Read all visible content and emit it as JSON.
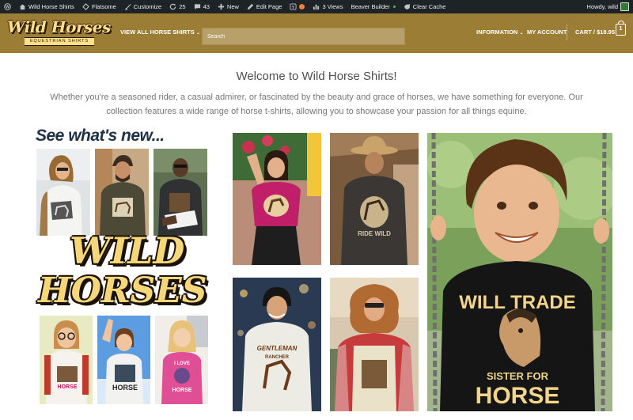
{
  "admin_bar": {
    "site_name": "Wild Horse Shirts",
    "flatsome": "Flatsome",
    "customize": "Customize",
    "updates_count": "25",
    "comments_count": "43",
    "new": "New",
    "edit_page": "Edit Page",
    "views": "3 Views",
    "beaver_builder": "Beaver Builder",
    "clear_cache": "Clear Cache",
    "howdy": "Howdy, wild"
  },
  "header": {
    "logo_main": "Wild Horses",
    "logo_sub": "EQUESTRIAN SHIRTS",
    "nav_all_shirts": "VIEW ALL HORSE SHIRTS",
    "search_placeholder": "Search",
    "information": "INFORMATION",
    "my_account": "MY ACCOUNT",
    "cart": "CART / $18.95",
    "cart_count": "1"
  },
  "main": {
    "title": "Welcome to Wild Horse Shirts!",
    "intro": "Whether you're a seasoned rider, a casual admirer, or fascinated by the beauty and grace of horses, we have something for everyone. Our collection features a wide range of horse t-shirts, allowing you to showcase your passion for all things equine.",
    "see_whats_new": "See what's new...",
    "collage_logo_line1": "WILD",
    "collage_logo_line2": "HORSES"
  },
  "shirt_prints": {
    "ride_wild": "RIDE WILD",
    "gentleman": "GENTLEMAN",
    "rancher": "RANCHER",
    "pink_shirt": "HORSE",
    "i_love": "I LOVE",
    "kid_trade_top": "WILL TRADE",
    "kid_trade_mid": "SISTER FOR",
    "kid_trade_bottom": "HORSE"
  },
  "colors": {
    "admin_bar": "#1d2327",
    "header": "#9c7d35",
    "accent_gold": "#f5d77a"
  }
}
